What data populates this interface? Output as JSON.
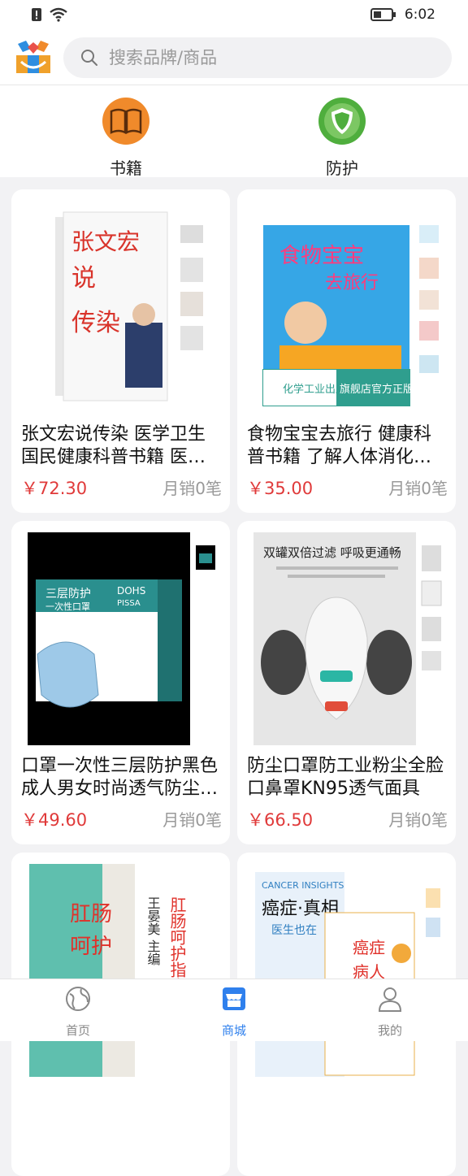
{
  "status_bar": {
    "time": "6:02"
  },
  "search": {
    "placeholder": "搜索品牌/商品"
  },
  "categories": [
    {
      "label": "书籍",
      "icon": "book-icon",
      "color": "#f08a2b"
    },
    {
      "label": "防护",
      "icon": "shield-icon",
      "color": "#4fae3d"
    }
  ],
  "products": [
    {
      "title": "张文宏说传染 医学卫生 国民健康科普书籍 医学科普知识读物",
      "price": "￥72.30",
      "sales": "月销0笔",
      "cover_text": "张文宏说传染"
    },
    {
      "title": "食物宝宝去旅行 健康科普书籍 了解人体消化系统 儿童绘本",
      "price": "￥35.00",
      "sales": "月销0笔",
      "cover_text": "食物宝宝去旅行",
      "publisher": "化学工业出版社",
      "store_tag": "旗舰店官方正版"
    },
    {
      "title": "口罩一次性三层防护黑色成人男女时尚透气防尘口罩",
      "price": "￥49.60",
      "sales": "月销0笔",
      "box_text": "三层防护 一次性口罩",
      "brand": "DOHS PISSA"
    },
    {
      "title": "防尘口罩防工业粉尘全脸口鼻罩KN95透气面具",
      "price": "￥66.50",
      "sales": "月销0笔",
      "ad_text": "双罐双倍过滤 呼吸更通畅"
    },
    {
      "title": "",
      "price": "",
      "sales": "",
      "cover_text": "肛肠呵护指南",
      "author": "王晏美 主编"
    },
    {
      "title": "",
      "price": "",
      "sales": "",
      "cover_text": "癌症·真相",
      "subtitle": "CANCER INSIGHTS"
    }
  ],
  "tabbar": [
    {
      "label": "首页",
      "icon": "globe-icon",
      "active": false
    },
    {
      "label": "商城",
      "icon": "store-icon",
      "active": true
    },
    {
      "label": "我的",
      "icon": "user-icon",
      "active": false
    }
  ],
  "colors": {
    "accent": "#2f80ed",
    "price": "#e03a3a",
    "background": "#f2f2f4"
  }
}
